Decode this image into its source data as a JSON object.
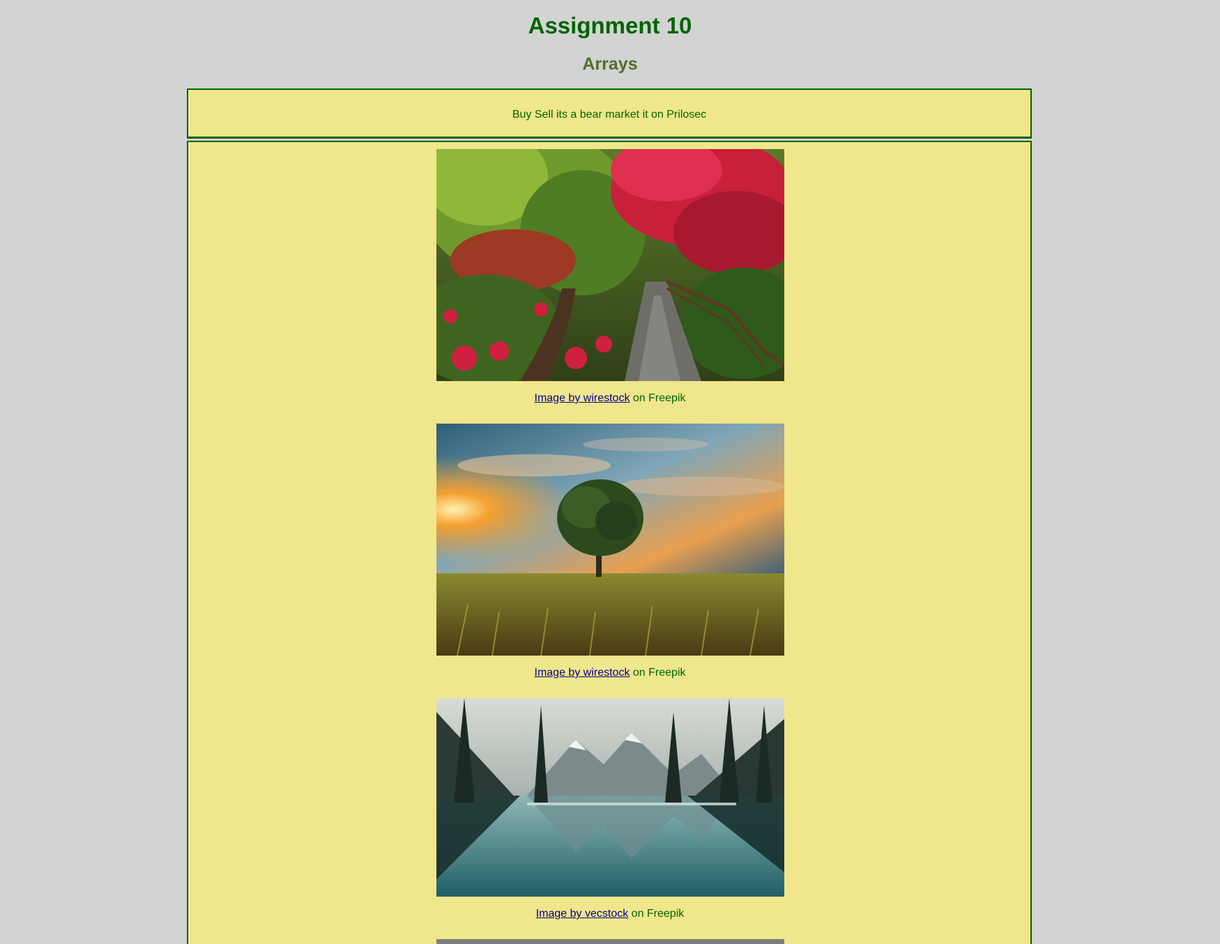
{
  "header": {
    "title": "Assignment 10",
    "subtitle": "Arrays"
  },
  "banner": {
    "message": "Buy Sell its a bear market it on Prilosec"
  },
  "gallery": [
    {
      "image_name": "japanese-garden-path-photo",
      "credit_link": "Image by wirestock",
      "credit_suffix": " on Freepik"
    },
    {
      "image_name": "tree-field-sunset-photo",
      "credit_link": "Image by wirestock",
      "credit_suffix": " on Freepik"
    },
    {
      "image_name": "mountain-lake-reflection-photo",
      "credit_link": "Image by vecstock",
      "credit_suffix": " on Freepik"
    }
  ],
  "colors": {
    "page_background": "#d3d3d3",
    "panel_background": "#f0e68c",
    "border": "#006400",
    "title": "#006400",
    "subtitle": "#556b2f",
    "link": "#00008b"
  }
}
